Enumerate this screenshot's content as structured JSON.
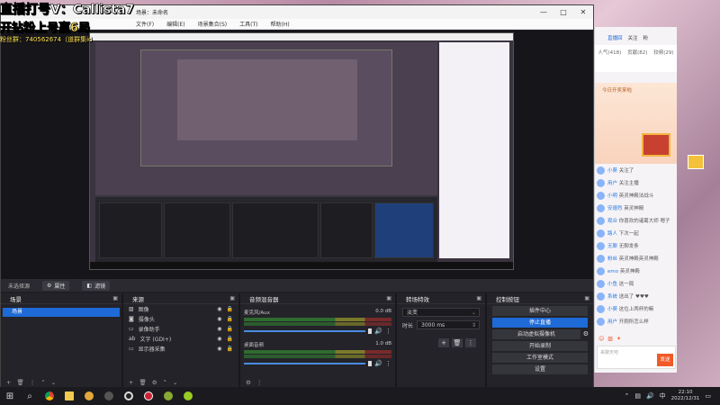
{
  "overlay": {
    "line1": "直播打号V：Callista7",
    "line2": "开钻粉上号赢6局",
    "line3": "粉丝群：740562674（道群集id"
  },
  "obs": {
    "title": "场景：未命名",
    "menu": [
      "文件(F)",
      "编辑(E)",
      "场景集合(S)",
      "工具(T)",
      "帮助(H)"
    ],
    "status_text": "未选择源",
    "properties_label": "属性",
    "filters_label": "滤镜",
    "scenes": {
      "header": "场景",
      "items": [
        "场景"
      ]
    },
    "sources": {
      "header": "来源",
      "items": [
        "图像",
        "摄像头",
        "录像助手",
        "文字 (GDI+)",
        "显示器采集"
      ]
    },
    "mixer": {
      "header": "音频混音器",
      "channels": [
        {
          "name": "麦克风/Aux",
          "db": "0.0 dB"
        },
        {
          "name": "桌面音频",
          "db": "1.0 dB"
        }
      ]
    },
    "transitions": {
      "header": "转场特效",
      "type": "淡变",
      "duration_label": "时长",
      "duration_value": "3000 ms"
    },
    "controls": {
      "header": "控制按钮",
      "buttons": [
        "插件中心",
        "停止直播",
        "启动虚拟摄像机",
        "开始录制",
        "工作室模式",
        "设置"
      ]
    }
  },
  "chat": {
    "tabs": [
      "直播回",
      "关注",
      "粉"
    ],
    "subtabs": [
      "人气(418)",
      "贡献(82)",
      "较频(29)"
    ],
    "promo_day": "今日开奖来啦",
    "messages": [
      {
        "user": "小葵",
        "text": "关注了"
      },
      {
        "user": "用户",
        "text": "关注主播"
      },
      {
        "user": "小明",
        "text": "英灵神殿法战斗"
      },
      {
        "user": "安德烈",
        "text": "英灵神殿"
      },
      {
        "user": "观众",
        "text": "你喜欢的诸葛大师 嗯子"
      },
      {
        "user": "路人",
        "text": "下次一起"
      },
      {
        "user": "无聊",
        "text": "无聊发条"
      },
      {
        "user": "粉丝",
        "text": "英灵神殿英灵神殿"
      },
      {
        "user": "emo",
        "text": "英灵神殿"
      },
      {
        "user": "小鱼",
        "text": "这一局"
      },
      {
        "user": "系统",
        "text": "送出了 ♥♥♥"
      },
      {
        "user": "小葵",
        "text": "这位上两杯的嘛"
      },
      {
        "user": "用户",
        "text": "开厕所怎么样"
      }
    ],
    "input_placeholder": "来聊天吧",
    "send_label": "发送"
  },
  "taskbar": {
    "time": "22:10",
    "date": "2022/12/31",
    "lang": "中"
  }
}
